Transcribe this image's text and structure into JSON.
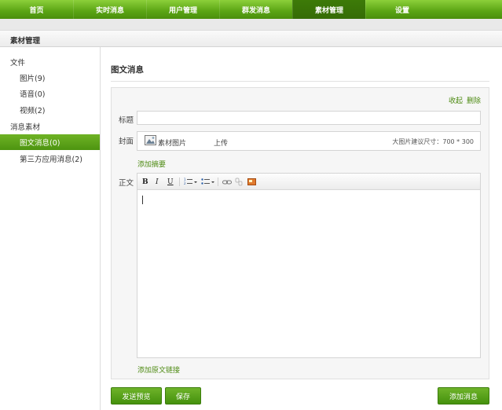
{
  "nav": {
    "tabs": [
      "首页",
      "实时消息",
      "用户管理",
      "群发消息",
      "素材管理",
      "设置"
    ],
    "active": "素材管理",
    "colors": {
      "nav_green": "#5aa414",
      "nav_active": "#3d7a08",
      "link_green": "#4d8a12"
    }
  },
  "section": {
    "title": "素材管理"
  },
  "sidebar": {
    "group_files": "文件",
    "item_images": "图片(9)",
    "item_voice": "语音(0)",
    "item_video": "视频(2)",
    "group_messages": "消息素材",
    "item_news": "图文消息(0)",
    "item_thirdparty": "第三方应用消息(2)"
  },
  "main": {
    "title": "图文消息",
    "collapse": "收起",
    "delete": "删除",
    "title_label": "标题",
    "title_value": "",
    "cover_label": "封面",
    "cover_material": "素材图片",
    "cover_upload": "上传",
    "cover_hint": "大图片建议尺寸：700 * 300",
    "add_summary": "添加摘要",
    "body_label": "正文",
    "toolbar": {
      "bold": "B",
      "italic": "I",
      "underline": "U",
      "icons": [
        "ordered-list-icon",
        "unordered-list-icon",
        "link-icon",
        "unlink-icon",
        "image-icon"
      ]
    },
    "add_source_link": "添加原文链接"
  },
  "buttons": {
    "preview": "发送预览",
    "save": "保存",
    "add_message": "添加消息"
  }
}
